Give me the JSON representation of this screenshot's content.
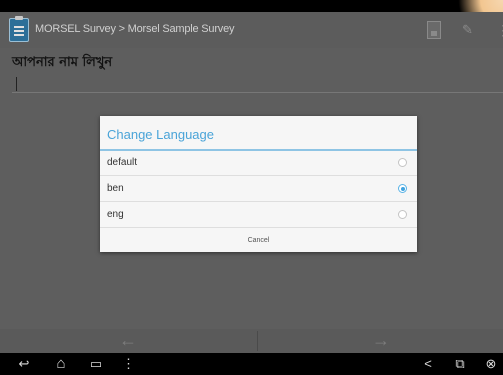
{
  "action_bar": {
    "title": "MORSEL Survey > Morsel Sample Survey",
    "icons": [
      "app-clipboard-icon",
      "save-icon",
      "tool-icon",
      "overflow-menu-icon"
    ]
  },
  "content": {
    "question": "আপনার নাম লিখুন",
    "answer_value": ""
  },
  "dialog": {
    "title": "Change Language",
    "options": [
      {
        "label": "default",
        "selected": false
      },
      {
        "label": "ben",
        "selected": true
      },
      {
        "label": "eng",
        "selected": false
      }
    ],
    "cancel_label": "Cancel"
  },
  "nav": {
    "prev_glyph": "←",
    "next_glyph": "→"
  },
  "system_bar": {
    "icons": [
      "back-icon",
      "home-icon",
      "recent-apps-icon",
      "menu-icon",
      "share-icon",
      "window-icon",
      "close-icon"
    ],
    "glyphs": {
      "back": "↩",
      "home": "⌂",
      "recent": "▭",
      "menu": "⋮",
      "share": "<",
      "window": "⧉",
      "close": "⊗"
    }
  },
  "colors": {
    "accent": "#4aa4d8",
    "action_bar": "#5c5c5c",
    "dim_background": "#5e5e5e"
  }
}
